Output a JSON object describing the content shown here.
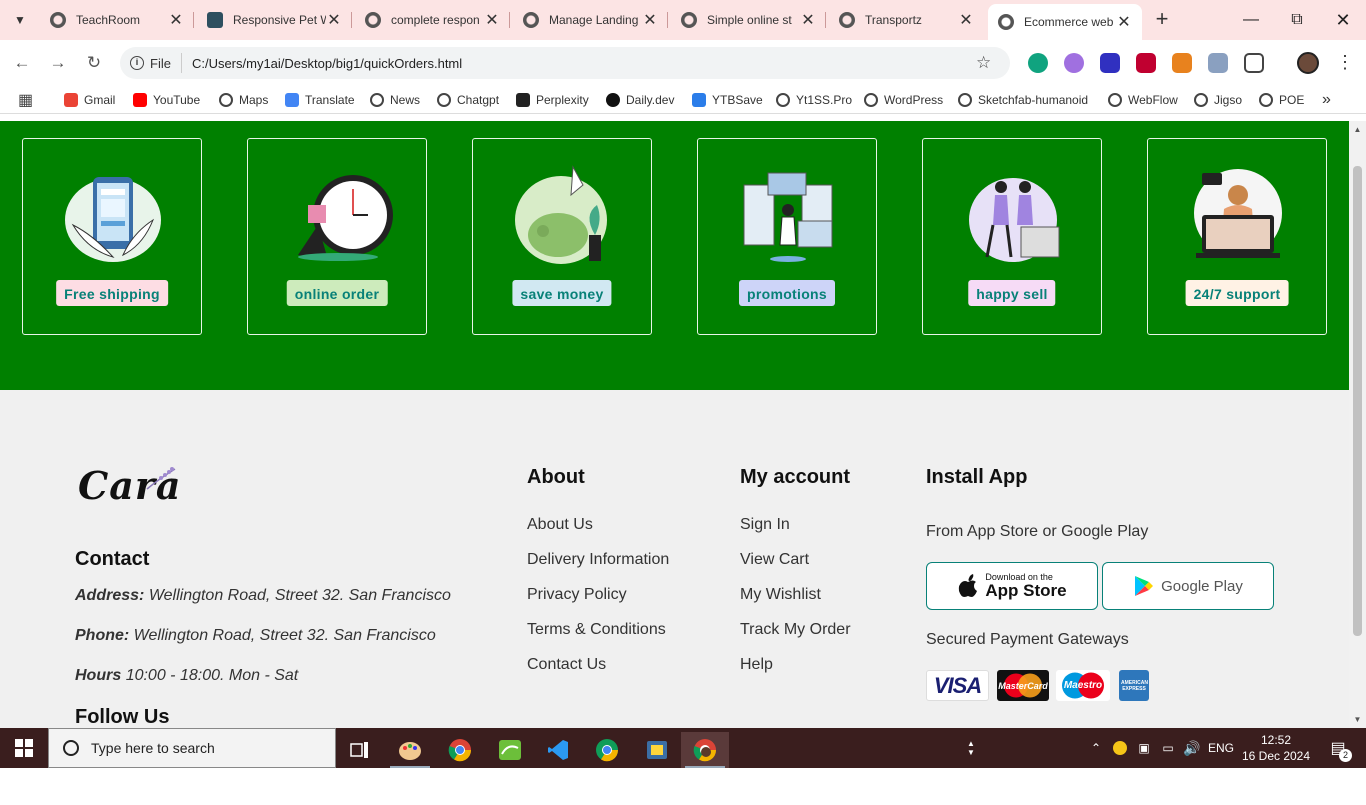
{
  "browser": {
    "tabs": [
      {
        "title": "TeachRoom",
        "icon": "globe",
        "active": false
      },
      {
        "title": "Responsive Pet W",
        "icon": "pet",
        "active": false
      },
      {
        "title": "complete respon",
        "icon": "globe",
        "active": false
      },
      {
        "title": "Manage Landing",
        "icon": "globe",
        "active": false
      },
      {
        "title": "Simple online st",
        "icon": "globe",
        "active": false
      },
      {
        "title": "Transportz",
        "icon": "globe",
        "active": false
      },
      {
        "title": "Ecommerce web",
        "icon": "globe",
        "active": true
      }
    ],
    "address": {
      "scheme_label": "File",
      "url": "C:/Users/my1ai/Desktop/big1/quickOrders.html"
    },
    "bookmarks": [
      {
        "label": "Gmail",
        "color": "#ea4335"
      },
      {
        "label": "YouTube",
        "color": "#ff0000"
      },
      {
        "label": "Maps",
        "color": "#444444"
      },
      {
        "label": "Translate",
        "color": "#4285f4"
      },
      {
        "label": "News",
        "color": "#444444"
      },
      {
        "label": "Chatgpt",
        "color": "#444444"
      },
      {
        "label": "Perplexity",
        "color": "#222222"
      },
      {
        "label": "Daily.dev",
        "color": "#111111"
      },
      {
        "label": "YTBSave",
        "color": "#2b7de9"
      },
      {
        "label": "Yt1SS.Pro",
        "color": "#444444"
      },
      {
        "label": "WordPress",
        "color": "#444444"
      },
      {
        "label": "Sketchfab-humanoid",
        "color": "#444444"
      },
      {
        "label": "WebFlow",
        "color": "#444444"
      },
      {
        "label": "Jigso",
        "color": "#444444"
      },
      {
        "label": "POE",
        "color": "#444444"
      }
    ]
  },
  "features": [
    {
      "label": "Free shipping",
      "bg": "#fddde4"
    },
    {
      "label": "online order",
      "bg": "#cdebbc"
    },
    {
      "label": "save money",
      "bg": "#d1e8f2"
    },
    {
      "label": "promotions",
      "bg": "#cdd4f8"
    },
    {
      "label": "happy sell",
      "bg": "#f6dbf6"
    },
    {
      "label": "24/7 support",
      "bg": "#fff2e5"
    }
  ],
  "footer": {
    "logo": "Cara",
    "contact_heading": "Contact",
    "address_label": "Address:",
    "address_value": "Wellington Road, Street 32. San Francisco",
    "phone_label": "Phone:",
    "phone_value": "Wellington Road, Street 32. San Francisco",
    "hours_label": "Hours",
    "hours_value": "10:00 - 18:00. Mon - Sat",
    "follow_heading": "Follow Us",
    "about_heading": "About",
    "about_links": [
      "About Us",
      "Delivery Information",
      "Privacy Policy",
      "Terms & Conditions",
      "Contact Us"
    ],
    "account_heading": "My account",
    "account_links": [
      "Sign In",
      "View Cart",
      "My Wishlist",
      "Track My Order",
      "Help"
    ],
    "install_heading": "Install App",
    "install_note": "From App Store or Google Play",
    "app_store_small": "Download on the",
    "app_store_big": "App Store",
    "google_play": "Google Play",
    "payments_note": "Secured Payment Gateways",
    "cards": [
      "VISA",
      "MasterCard",
      "Maestro",
      "AMERICAN EXPRESS"
    ]
  },
  "taskbar": {
    "search_placeholder": "Type here to search",
    "language": "ENG",
    "time": "12:52",
    "date": "16 Dec 2024",
    "notifications": "2"
  }
}
